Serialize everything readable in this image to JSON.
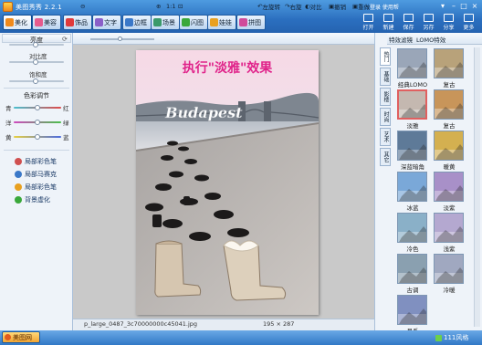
{
  "app": {
    "title": "美图秀秀 2.2.1"
  },
  "tabs": [
    {
      "label": "美化",
      "icon": "beautify-icon",
      "color": "#f08a1c",
      "active": true
    },
    {
      "label": "美容",
      "icon": "cosmetic-icon",
      "color": "#e65b8d",
      "active": false
    },
    {
      "label": "饰品",
      "icon": "accessory-icon",
      "color": "#e03a3a",
      "active": false
    },
    {
      "label": "文字",
      "icon": "text-icon",
      "color": "#8a5fc8",
      "active": false
    },
    {
      "label": "边框",
      "icon": "border-icon",
      "color": "#3a78c8",
      "active": false
    },
    {
      "label": "场景",
      "icon": "scene-icon",
      "color": "#3a9a6a",
      "active": false
    },
    {
      "label": "闪图",
      "icon": "flash-icon",
      "color": "#3aa83a",
      "active": false
    },
    {
      "label": "娃娃",
      "icon": "doll-icon",
      "color": "#e8a020",
      "active": false
    },
    {
      "label": "拼图",
      "icon": "puzzle-icon",
      "color": "#d04a9a",
      "active": false
    }
  ],
  "top_tools": [
    {
      "label": "打开",
      "icon": "open-icon"
    },
    {
      "label": "新建",
      "icon": "new-icon"
    },
    {
      "label": "保存",
      "icon": "save-icon"
    },
    {
      "label": "另存",
      "icon": "save-as-icon"
    },
    {
      "label": "分享",
      "icon": "share-icon"
    },
    {
      "label": "更多",
      "icon": "more-icon"
    }
  ],
  "user": {
    "link": "登录  使用帮"
  },
  "left": {
    "basic_title": "亮度",
    "basic": [
      "亮度",
      "对比度",
      "饱和度"
    ],
    "color_title": "色彩调节",
    "color_rows": [
      {
        "left": "青",
        "right": "红",
        "level": 0.5
      },
      {
        "left": "洋",
        "right": "绿",
        "level": 0.5
      },
      {
        "left": "黄",
        "right": "蓝",
        "level": 0.5
      }
    ],
    "items": [
      {
        "label": "局部彩色笔",
        "color": "#d05050",
        "icon": "color-pen-icon"
      },
      {
        "label": "局部马赛克",
        "color": "#3a78c8",
        "icon": "mosaic-icon"
      },
      {
        "label": "局部彩色笔",
        "color": "#e8a020",
        "icon": "color-brush-icon"
      },
      {
        "label": "背景虚化",
        "color": "#3aa83a",
        "icon": "blur-icon"
      }
    ]
  },
  "center_toolbar": {
    "zoom_label": "1:1",
    "rotate_left": "左旋转",
    "rotate_right": "右旋",
    "compare": "对比",
    "undo": "撤销",
    "redo": "重做"
  },
  "photo": {
    "caption": "执行\"淡雅\"效果",
    "watermark": "Budapest",
    "caption_color": "#e0238a"
  },
  "status": {
    "file": "p_large_0487_3c70000000c45041.jpg",
    "size": "195 × 287"
  },
  "right": {
    "header": {
      "a": "特效滤镜",
      "b": "LOMO特效"
    },
    "vtabs": [
      "热门",
      "基础",
      "影楼",
      "时尚",
      "艺术",
      "其它"
    ],
    "filters": [
      {
        "label": "经典LOMO",
        "tone": "#9aa6b8",
        "selected": false
      },
      {
        "label": "复古",
        "tone": "#b8a27a",
        "selected": false
      },
      {
        "label": "淡雅",
        "tone": "#c4b8b0",
        "selected": true
      },
      {
        "label": "复古",
        "tone": "#c8955a",
        "selected": false
      },
      {
        "label": "深蓝暗角",
        "tone": "#5e7a98",
        "selected": false
      },
      {
        "label": "暖黄",
        "tone": "#d4b050",
        "selected": false
      },
      {
        "label": "冰蓝",
        "tone": "#7aa8d8",
        "selected": false
      },
      {
        "label": "淡紫",
        "tone": "#a890c8",
        "selected": false
      },
      {
        "label": "冷色",
        "tone": "#8ab0c8",
        "selected": false
      },
      {
        "label": "浅紫",
        "tone": "#b4a8d0",
        "selected": false
      },
      {
        "label": "古调",
        "tone": "#8aa0b0",
        "selected": false
      },
      {
        "label": "冷暖",
        "tone": "#a0a8c0",
        "selected": false
      },
      {
        "label": "月系",
        "tone": "#8090c0",
        "selected": false
      }
    ]
  },
  "bottom": {
    "home_label": "美图网",
    "right_label": "111风格"
  }
}
